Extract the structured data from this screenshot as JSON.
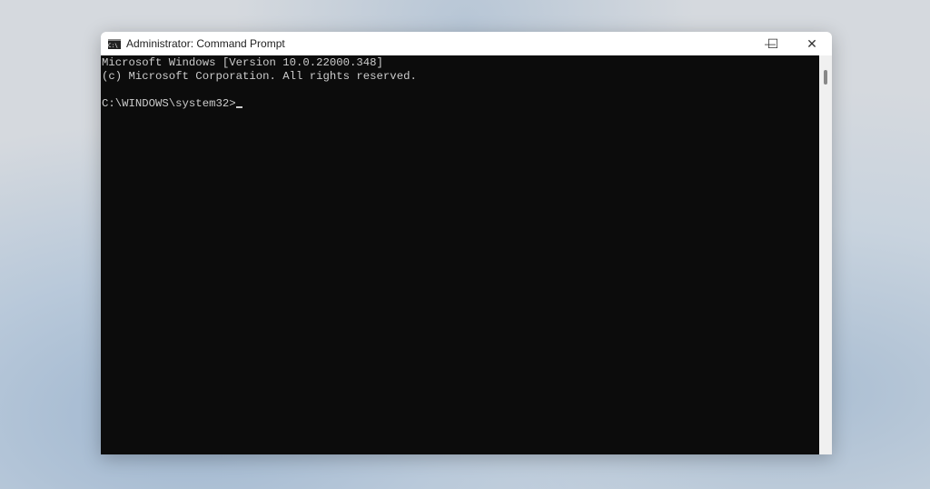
{
  "window": {
    "title": "Administrator: Command Prompt",
    "minimize": "—",
    "maximize": "☐",
    "close": "✕"
  },
  "console": {
    "lines": [
      "Microsoft Windows [Version 10.0.22000.348]",
      "(c) Microsoft Corporation. All rights reserved.",
      ""
    ],
    "prompt": "C:\\WINDOWS\\system32>"
  }
}
